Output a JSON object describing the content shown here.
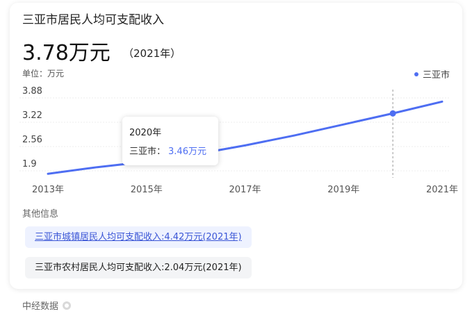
{
  "header": {
    "title": "三亚市居民人均可支配收入",
    "value": "3.78万元",
    "year_tag": "（2021年）",
    "unit": "单位：万元"
  },
  "legend": {
    "label": "三亚市",
    "color": "#4e6ef2"
  },
  "chart_data": {
    "type": "line",
    "title": "",
    "xlabel": "",
    "ylabel": "",
    "x": [
      2013,
      2014,
      2015,
      2016,
      2017,
      2018,
      2019,
      2020,
      2021
    ],
    "x_tick_labels": [
      "2013年",
      "2015年",
      "2017年",
      "2019年",
      "2021年"
    ],
    "x_tick_values": [
      2013,
      2015,
      2017,
      2019,
      2021
    ],
    "y_tick_labels": [
      "3.88",
      "3.22",
      "2.56",
      "1.9"
    ],
    "y_tick_values": [
      3.88,
      3.22,
      2.56,
      1.9
    ],
    "ylim": [
      1.9,
      3.88
    ],
    "series": [
      {
        "name": "三亚市",
        "values": [
          1.82,
          2.0,
          2.15,
          2.35,
          2.59,
          2.86,
          3.16,
          3.46,
          3.78
        ]
      }
    ],
    "highlight_index": 7,
    "grid": true,
    "legend_position": "top-right"
  },
  "tooltip": {
    "year": "2020年",
    "series_label": "三亚市：",
    "value": "3.46万元"
  },
  "other_info": {
    "title": "其他信息",
    "items": [
      "三亚市城镇居民人均可支配收入:4.42万元(2021年)",
      "三亚市农村居民人均可支配收入:2.04万元(2021年)"
    ]
  },
  "source": {
    "label": "中经数据"
  }
}
